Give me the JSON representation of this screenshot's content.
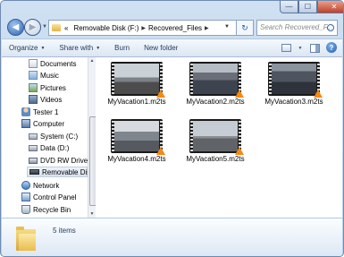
{
  "window": {
    "controls": {
      "minimize": "—",
      "maximize": "☐",
      "close": "✕"
    }
  },
  "nav": {
    "address": {
      "overflow": "«",
      "crumbs": [
        "Removable Disk (F:)",
        "Recovered_Files"
      ],
      "separator": "▶"
    },
    "search_placeholder": "Search Recovered_F..."
  },
  "toolbar": {
    "organize": "Organize",
    "share_with": "Share with",
    "burn": "Burn",
    "new_folder": "New folder",
    "help": "?"
  },
  "sidebar": {
    "items": [
      {
        "label": "Documents",
        "icon": "documents-icon"
      },
      {
        "label": "Music",
        "icon": "music-icon"
      },
      {
        "label": "Pictures",
        "icon": "pictures-icon"
      },
      {
        "label": "Videos",
        "icon": "videos-icon"
      },
      {
        "label": "Tester 1",
        "icon": "user-icon"
      },
      {
        "label": "Computer",
        "icon": "computer-icon"
      },
      {
        "label": "System (C:)",
        "icon": "drive-icon"
      },
      {
        "label": "Data (D:)",
        "icon": "drive-icon"
      },
      {
        "label": "DVD RW Drive (",
        "icon": "dvd-drive-icon"
      },
      {
        "label": "Removable Dis",
        "icon": "usb-drive-icon"
      },
      {
        "label": "Network",
        "icon": "network-icon"
      },
      {
        "label": "Control Panel",
        "icon": "control-panel-icon"
      },
      {
        "label": "Recycle Bin",
        "icon": "recycle-bin-icon"
      }
    ],
    "selected": "Removable Dis"
  },
  "files": [
    {
      "name": "MyVacation1.m2ts",
      "scene": "airport"
    },
    {
      "name": "MyVacation2.m2ts",
      "scene": "crowd"
    },
    {
      "name": "MyVacation3.m2ts",
      "scene": "crowd-dark"
    },
    {
      "name": "MyVacation4.m2ts",
      "scene": "group"
    },
    {
      "name": "MyVacation5.m2ts",
      "scene": "harbor"
    }
  ],
  "details": {
    "count": "5 items"
  },
  "colors": {
    "chrome": "#cfe0f2",
    "text": "#1e395b",
    "vlc_cone": "#f28a15"
  }
}
